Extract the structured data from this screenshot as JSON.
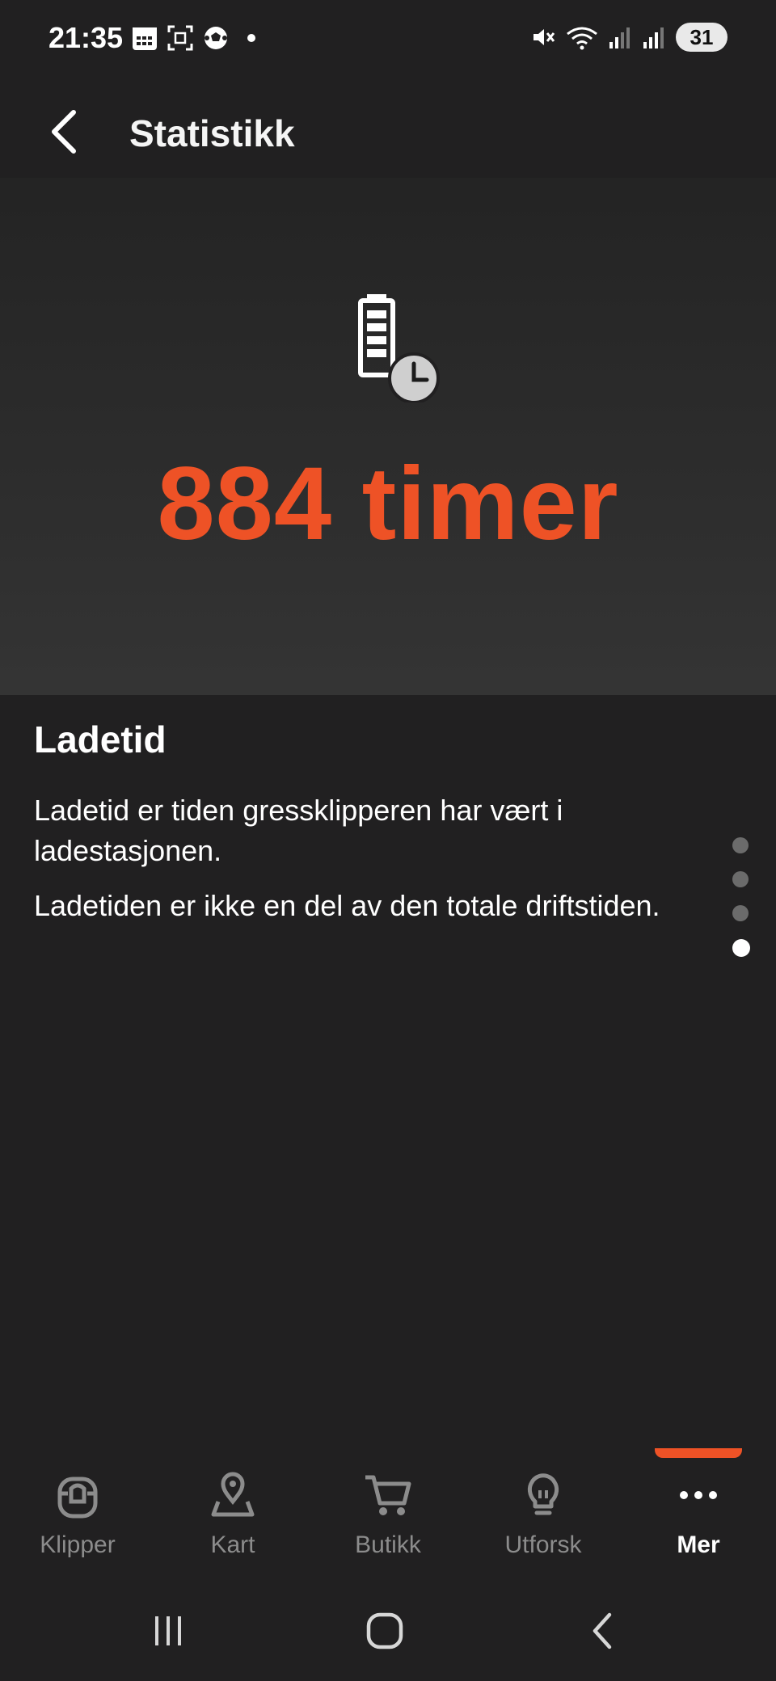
{
  "status_bar": {
    "time": "21:35",
    "battery_level": "31",
    "left_icons": [
      "calendar-icon",
      "screenshot-icon",
      "soccer-ball-icon",
      "dot-icon"
    ],
    "right_icons": [
      "mute-icon",
      "wifi-icon",
      "signal-icon",
      "signal-icon"
    ]
  },
  "header": {
    "title": "Statistikk",
    "back_icon": "back-arrow-icon"
  },
  "hero": {
    "icon": "battery-clock-icon",
    "value": "884 timer",
    "accent_color": "#ee5226"
  },
  "content": {
    "title": "Ladetid",
    "paragraph_1": "Ladetid er tiden gressklipperen har vært i ladestasjonen.",
    "paragraph_2": "Ladetiden er ikke en del av den totale driftstiden."
  },
  "pager": {
    "total": 4,
    "active_index": 4
  },
  "bottom_nav": {
    "items": [
      {
        "label": "Klipper",
        "icon": "mower-icon",
        "active": false
      },
      {
        "label": "Kart",
        "icon": "map-pin-icon",
        "active": false
      },
      {
        "label": "Butikk",
        "icon": "cart-icon",
        "active": false
      },
      {
        "label": "Utforsk",
        "icon": "lightbulb-icon",
        "active": false
      },
      {
        "label": "Mer",
        "icon": "more-icon",
        "active": true
      }
    ]
  },
  "system_nav": {
    "buttons": [
      "recents-icon",
      "home-icon",
      "back-icon"
    ]
  }
}
